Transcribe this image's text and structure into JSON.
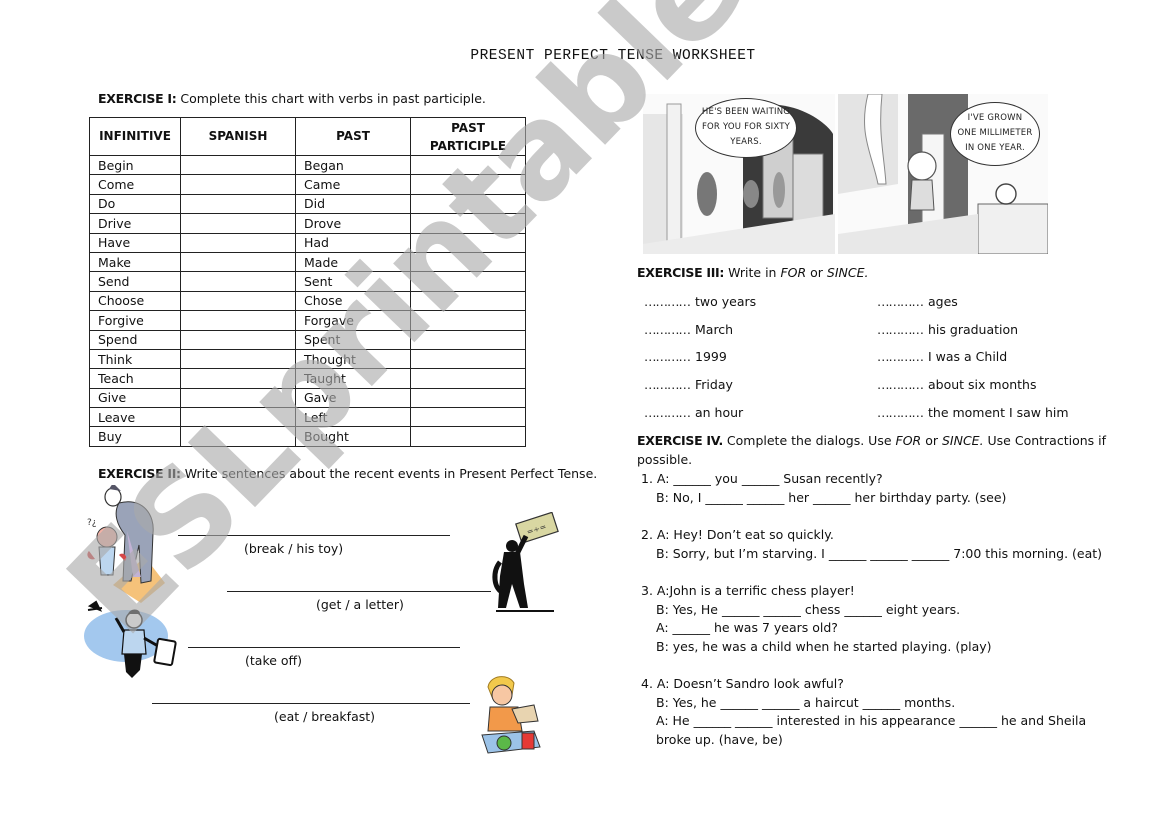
{
  "title": "PRESENT PERFECT TENSE WORKSHEET",
  "exercise1": {
    "label": "EXERCISE I:",
    "instruction": " Complete this chart with verbs in past participle.",
    "headers": [
      "INFINITIVE",
      "SPANISH",
      "PAST",
      "PAST PARTICIPLE"
    ],
    "rows": [
      {
        "infinitive": "Begin",
        "spanish": "",
        "past": "Began",
        "past_participle": ""
      },
      {
        "infinitive": "Come",
        "spanish": "",
        "past": "Came",
        "past_participle": ""
      },
      {
        "infinitive": "Do",
        "spanish": "",
        "past": "Did",
        "past_participle": ""
      },
      {
        "infinitive": "Drive",
        "spanish": "",
        "past": "Drove",
        "past_participle": ""
      },
      {
        "infinitive": "Have",
        "spanish": "",
        "past": "Had",
        "past_participle": ""
      },
      {
        "infinitive": "Make",
        "spanish": "",
        "past": "Made",
        "past_participle": ""
      },
      {
        "infinitive": "Send",
        "spanish": "",
        "past": "Sent",
        "past_participle": ""
      },
      {
        "infinitive": "Choose",
        "spanish": "",
        "past": "Chose",
        "past_participle": ""
      },
      {
        "infinitive": "Forgive",
        "spanish": "",
        "past": "Forgave",
        "past_participle": ""
      },
      {
        "infinitive": "Spend",
        "spanish": "",
        "past": "Spent",
        "past_participle": ""
      },
      {
        "infinitive": "Think",
        "spanish": "",
        "past": "Thought",
        "past_participle": ""
      },
      {
        "infinitive": "Teach",
        "spanish": "",
        "past": "Taught",
        "past_participle": ""
      },
      {
        "infinitive": "Give",
        "spanish": "",
        "past": "Gave",
        "past_participle": ""
      },
      {
        "infinitive": "Leave",
        "spanish": "",
        "past": "Left",
        "past_participle": ""
      },
      {
        "infinitive": "Buy",
        "spanish": "",
        "past": "Bought",
        "past_participle": ""
      }
    ]
  },
  "exercise2": {
    "label": "EXERCISE II:",
    "instruction": " Write sentences about the recent events in Present Perfect Tense.",
    "items": [
      {
        "hint": "(break / his toy)",
        "picture": "father-scolding-child-illustration"
      },
      {
        "hint": "(get / a letter)",
        "picture": "man-holding-letter-illustration"
      },
      {
        "hint": "(take off)",
        "picture": "businessman-airplane-illustration"
      },
      {
        "hint": "(eat / breakfast)",
        "picture": "boy-eating-breakfast-illustration"
      }
    ]
  },
  "cartoons": [
    {
      "speech": [
        "HE'S BEEN WAITING",
        "FOR YOU FOR SIXTY",
        "YEARS."
      ]
    },
    {
      "speech": [
        "I'VE GROWN",
        "ONE MILLIMETER",
        "IN ONE YEAR."
      ]
    }
  ],
  "exercise3": {
    "label": "EXERCISE III:",
    "instruction_pre": " Write in ",
    "for_word": "FOR",
    "or_word": " or ",
    "since_word": "SINCE.",
    "dots": "…………",
    "left": [
      "two years",
      "March",
      "1999",
      "Friday",
      "an hour"
    ],
    "right": [
      "ages",
      "his graduation",
      "I was a Child",
      "about six months",
      "the moment I saw him"
    ]
  },
  "exercise4": {
    "label": "EXERCISE IV.",
    "instruction_a": " Complete the dialogs. Use ",
    "for_word": "FOR",
    "or_word": " or ",
    "since_word": "SINCE.",
    "instruction_b": " Use Contractions if",
    "instruction_c": "possible.",
    "dialogs": [
      [
        "1. A: ______ you ______ Susan recently?",
        "B: No, I ______ ______ her ______ her birthday party. (see)"
      ],
      [
        "2. A: Hey! Don’t eat so quickly.",
        "B: Sorry, but I’m starving. I ______ ______ ______ 7:00 this morning. (eat)"
      ],
      [
        "3. A:John is a terrific chess player!",
        "B: Yes, He ______ ______ chess ______ eight years.",
        "A: ______ he was 7 years old?",
        "B: yes, he was a child when he started playing. (play)"
      ],
      [
        "4. A: Doesn’t Sandro look awful?",
        "B: Yes, he ______ ______ a haircut ______ months.",
        "A: He ______ ______ interested in his appearance ______ he and Sheila",
        "broke up. (have, be)"
      ]
    ]
  },
  "watermark": "ESLprintables.com",
  "colors": {
    "text": "#111111",
    "border": "#222222",
    "watermark": "#aaaaaa"
  }
}
